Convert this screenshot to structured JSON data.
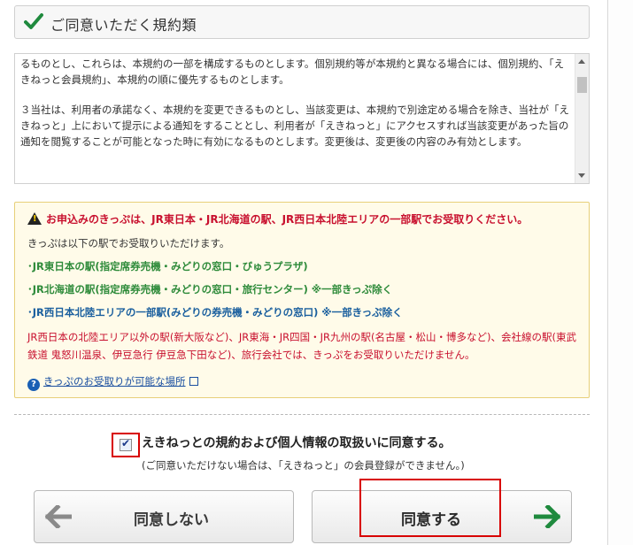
{
  "header": {
    "title": "ご同意いただく規約類"
  },
  "terms": {
    "para1": "るものとし、これらは、本規約の一部を構成するものとします。個別規約等が本規約と異なる場合には、個別規約、「えきねっと会員規約」、本規約の順に優先するものとします。",
    "para2": "３当社は、利用者の承諾なく、本規約を変更できるものとし、当該変更は、本規約で別途定める場合を除き、当社が「えきねっと」上において提示による通知をすることとし、利用者が「えきねっと」にアクセスすれば当該変更があった旨の通知を閲覧することが可能となった時に有効になるものとします。変更後は、変更後の内容のみ有効とします。"
  },
  "notice": {
    "warning": "お申込みのきっぷは、JR東日本・JR北海道の駅、JR西日本北陸エリアの一部駅でお受取りください。",
    "intro": "きっぷは以下の駅でお受取りいただけます。",
    "east": "･JR東日本の駅(指定席券売機・みどりの窓口・びゅうプラザ)",
    "hokkaido": "･JR北海道の駅(指定席券売機・みどりの窓口・旅行センター) ※一部きっぷ除く",
    "west": "･JR西日本北陸エリアの一部駅(みどりの券売機・みどりの窓口) ※一部きっぷ除く",
    "caution": "JR西日本の北陸エリア以外の駅(新大阪など)、JR東海・JR四国・JR九州の駅(名古屋・松山・博多など)、会社線の駅(東武鉄道 鬼怒川温泉、伊豆急行 伊豆急下田など)、旅行会社では、きっぷをお受取りいただけません。",
    "help_link": "きっぷのお受取りが可能な場所"
  },
  "agreement": {
    "label": "えきねっとの規約および個人情報の取扱いに同意する。",
    "sub": "(ご同意いただけない場合は、「えきねっと」の会員登録ができません。)",
    "checked": true
  },
  "buttons": {
    "disagree": "同意しない",
    "agree": "同意する"
  },
  "colors": {
    "accent_green": "#1f8a3e",
    "warning_red": "#c8102e",
    "highlight_red": "#d80000"
  }
}
